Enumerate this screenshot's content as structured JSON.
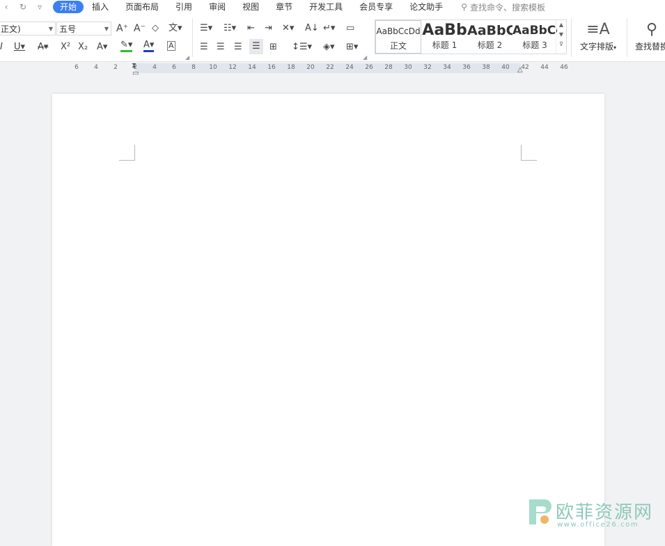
{
  "menubar": {
    "undo_icon": "undo-icon",
    "redo_icon": "redo-icon",
    "quick_access": "▿",
    "tabs": [
      "开始",
      "插入",
      "页面布局",
      "引用",
      "审阅",
      "视图",
      "章节",
      "开发工具",
      "会员专享",
      "论文助手"
    ],
    "active_tab": 0,
    "search_placeholder": "查找命令、搜索模板"
  },
  "ribbon": {
    "font_name": "正文)",
    "font_size": "五号",
    "style_gallery": [
      {
        "preview": "AaBbCcDd",
        "name": "正文"
      },
      {
        "preview": "AaBb",
        "name": "标题 1"
      },
      {
        "preview": "AaBbC",
        "name": "标题 2"
      },
      {
        "preview": "AaBbCc",
        "name": "标题 3"
      }
    ],
    "text_layout_label": "文字排版",
    "find_replace_label": "查找替换"
  },
  "ruler": {
    "ticks": [
      "6",
      "4",
      "2",
      "2",
      "4",
      "6",
      "8",
      "10",
      "12",
      "14",
      "16",
      "18",
      "20",
      "22",
      "24",
      "26",
      "28",
      "30",
      "32",
      "34",
      "36",
      "38",
      "40",
      "42",
      "44",
      "46"
    ]
  },
  "watermark": {
    "title": "欧菲资源网",
    "url": "www.office26.com"
  },
  "colors": {
    "accent": "#3d7fee",
    "highlight": "#2fbd2f",
    "font_color": "#1f3fbf",
    "watermark": "#8ec9b8"
  }
}
